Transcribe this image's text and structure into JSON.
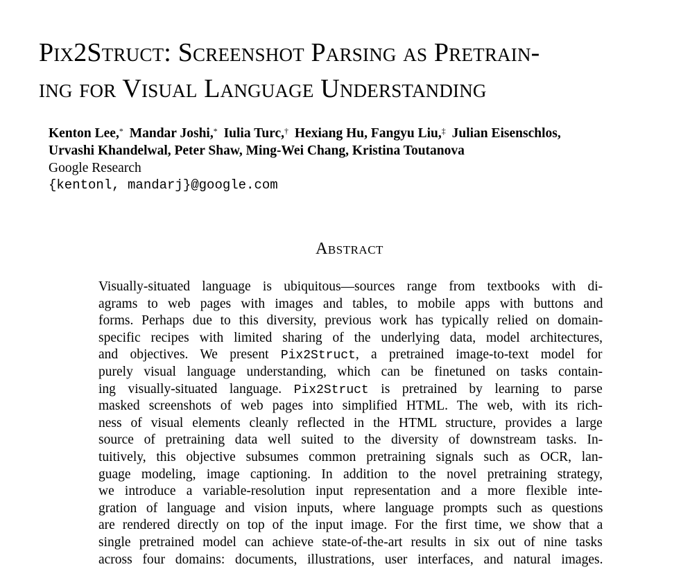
{
  "paper": {
    "title_lines": [
      "Pix2Struct:  Screenshot Parsing as Pretrain-",
      "ing for Visual Language Understanding"
    ],
    "authors": {
      "line1": [
        {
          "name": "Kenton Lee,",
          "mark": "*"
        },
        {
          "name": "Mandar Joshi,",
          "mark": "*"
        },
        {
          "name": "Iulia Turc,",
          "mark": "†"
        },
        {
          "name": "Hexiang Hu, Fangyu Liu,",
          "mark": "‡"
        },
        {
          "name": "Julian Eisenschlos,",
          "mark": ""
        }
      ],
      "line2": "Urvashi Khandelwal, Peter Shaw, Ming-Wei Chang, Kristina Toutanova",
      "affiliation": "Google Research",
      "email": "{kentonl, mandarj}@google.com"
    },
    "abstract": {
      "heading": "Abstract",
      "model_name": "Pix2Struct",
      "lines": [
        {
          "pre": "Visually-situated language is ubiquitous—sources range from textbooks with di-"
        },
        {
          "pre": "agrams to web pages with images and tables, to mobile apps with buttons and"
        },
        {
          "pre": "forms. Perhaps due to this diversity, previous work has typically relied on domain-"
        },
        {
          "pre": "specific recipes with limited sharing of the underlying data, model architectures,"
        },
        {
          "pre": "and objectives. We present ",
          "mono": "Pix2Struct",
          "post": ", a pretrained image-to-text model for"
        },
        {
          "pre": "purely visual language understanding, which can be finetuned on tasks contain-"
        },
        {
          "pre": "ing visually-situated language. ",
          "mono": "Pix2Struct",
          "post": " is pretrained by learning to parse"
        },
        {
          "pre": "masked screenshots of web pages into simplified HTML. The web, with its rich-"
        },
        {
          "pre": "ness of visual elements cleanly reflected in the HTML structure, provides a large"
        },
        {
          "pre": "source of pretraining data well suited to the diversity of downstream tasks. In-"
        },
        {
          "pre": "tuitively, this objective subsumes common pretraining signals such as OCR, lan-"
        },
        {
          "pre": "guage modeling, image captioning. In addition to the novel pretraining strategy,"
        },
        {
          "pre": "we introduce a variable-resolution input representation and a more flexible inte-"
        },
        {
          "pre": "gration of language and vision inputs, where language prompts such as questions"
        },
        {
          "pre": "are rendered directly on top of the input image. For the first time, we show that a"
        },
        {
          "pre": "single pretrained model can achieve state-of-the-art results in six out of nine tasks"
        },
        {
          "pre": "across four domains: documents, illustrations, user interfaces, and natural images."
        }
      ]
    }
  }
}
